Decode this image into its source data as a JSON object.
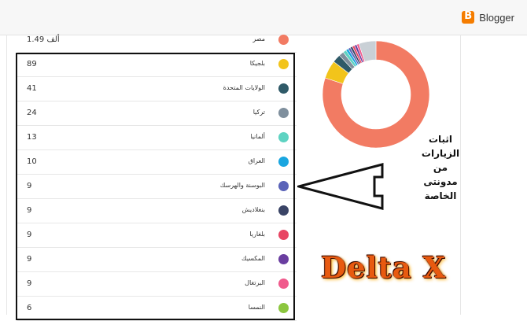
{
  "app": {
    "name": "Blogger"
  },
  "rows": [
    {
      "value": "1.49 ألف",
      "country": "مصر",
      "color": "#f27b63"
    },
    {
      "value": "89",
      "country": "بلجيكا",
      "color": "#f2c41b"
    },
    {
      "value": "41",
      "country": "الولايات المتحدة",
      "color": "#2f5a68"
    },
    {
      "value": "24",
      "country": "تركيا",
      "color": "#7f8f9d"
    },
    {
      "value": "13",
      "country": "ألمانيا",
      "color": "#5ed3c2"
    },
    {
      "value": "10",
      "country": "العراق",
      "color": "#1aa6e0"
    },
    {
      "value": "9",
      "country": "البوسنة والهرسك",
      "color": "#5a63b8"
    },
    {
      "value": "9",
      "country": "بنغلاديش",
      "color": "#3a4466"
    },
    {
      "value": "9",
      "country": "بلغاريا",
      "color": "#e84563"
    },
    {
      "value": "9",
      "country": "المكسيك",
      "color": "#6a3ea0"
    },
    {
      "value": "9",
      "country": "البرتغال",
      "color": "#f05a8c"
    },
    {
      "value": "6",
      "country": "النمسا",
      "color": "#8cc63f"
    }
  ],
  "donut": {
    "ring_color": "#f27b63",
    "segments": [
      {
        "fraction": 0.8,
        "color": "#f27b63"
      },
      {
        "fraction": 0.055,
        "color": "#f2c41b"
      },
      {
        "fraction": 0.025,
        "color": "#2f5a68"
      },
      {
        "fraction": 0.015,
        "color": "#7f8f9d"
      },
      {
        "fraction": 0.01,
        "color": "#5ed3c2"
      },
      {
        "fraction": 0.008,
        "color": "#1aa6e0"
      },
      {
        "fraction": 0.007,
        "color": "#5a63b8"
      },
      {
        "fraction": 0.007,
        "color": "#3a4466"
      },
      {
        "fraction": 0.007,
        "color": "#e84563"
      },
      {
        "fraction": 0.007,
        "color": "#6a3ea0"
      },
      {
        "fraction": 0.007,
        "color": "#f05a8c"
      },
      {
        "fraction": 0.052,
        "color": "#c9d0d6"
      }
    ]
  },
  "annotation": {
    "line1": "اثبات الزيارات من",
    "line2": "مدونتى الخاصة"
  },
  "logo": {
    "text": "Delta X"
  }
}
